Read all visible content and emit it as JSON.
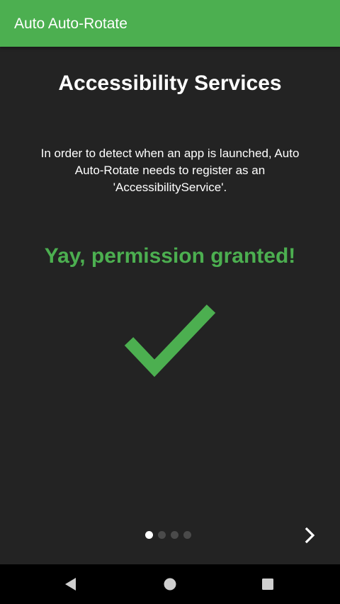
{
  "app_bar": {
    "title": "Auto Auto-Rotate",
    "color": "#4caf50"
  },
  "page": {
    "heading": "Accessibility Services",
    "description": "In order to detect when an app is launched, Auto Auto-Rotate needs to register as an 'AccessibilityService'.",
    "status_text": "Yay, permission granted!",
    "status_color": "#4caf50",
    "status_icon": "checkmark-icon"
  },
  "pager": {
    "total_pages": 4,
    "current_page": 1,
    "next_icon": "chevron-right-icon"
  },
  "nav_bar": {
    "back_icon": "back-triangle-icon",
    "home_icon": "home-circle-icon",
    "recents_icon": "recents-square-icon"
  }
}
